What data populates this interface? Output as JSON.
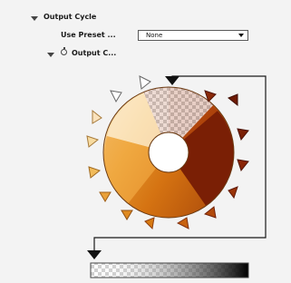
{
  "output_cycle": {
    "title": "Output Cycle",
    "use_preset_label": "Use Preset ...",
    "use_preset_value": "None",
    "output_cycle_sub_label": "Output C...",
    "colors": {
      "panel_bg": "#f3f3f3",
      "line": "#1a1a1a",
      "dark_red": "#7a1f05",
      "orange": "#d77a12",
      "light": "#fff8ec"
    }
  }
}
